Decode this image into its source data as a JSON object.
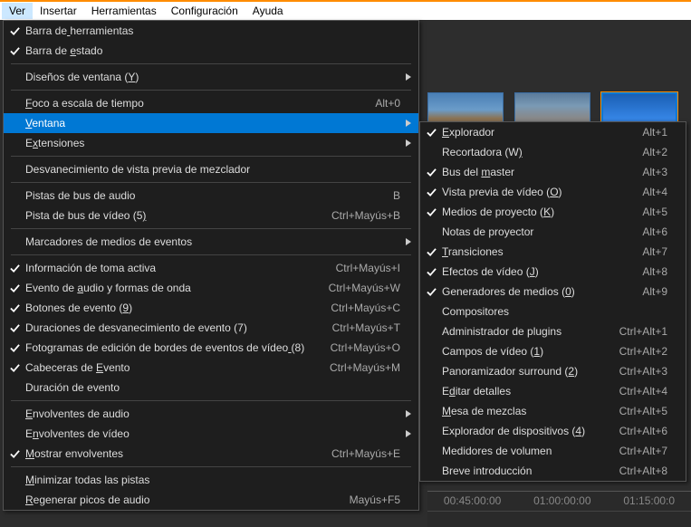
{
  "menubar": {
    "items": [
      "Ver",
      "Insertar",
      "Herramientas",
      "Configuración",
      "Ayuda"
    ],
    "active": 0
  },
  "menu1": [
    {
      "type": "item",
      "check": true,
      "label": "Barra de herramientas",
      "u": 8
    },
    {
      "type": "item",
      "check": true,
      "label": "Barra de estado",
      "u": 9
    },
    {
      "type": "sep"
    },
    {
      "type": "item",
      "label": "Diseños de ventana (Y)",
      "u": 20,
      "arrow": true
    },
    {
      "type": "sep"
    },
    {
      "type": "item",
      "label": "Foco a escala de tiempo",
      "u": 0,
      "shortcut": "Alt+0"
    },
    {
      "type": "item",
      "label": "Ventana",
      "u": 0,
      "arrow": true,
      "highlighted": true
    },
    {
      "type": "item",
      "label": "Extensiones",
      "u": 1,
      "arrow": true
    },
    {
      "type": "sep"
    },
    {
      "type": "item",
      "label": "Desvanecimiento de vista previa de mezclador"
    },
    {
      "type": "sep"
    },
    {
      "type": "item",
      "label": "Pistas de bus de audio",
      "shortcut": "B"
    },
    {
      "type": "item",
      "label": "Pista de bus de vídeo (5)",
      "u": 24,
      "shortcut": "Ctrl+Mayús+B"
    },
    {
      "type": "sep"
    },
    {
      "type": "item",
      "label": "Marcadores de medios de eventos",
      "arrow": true
    },
    {
      "type": "sep"
    },
    {
      "type": "item",
      "check": true,
      "label": "Información de toma activa",
      "shortcut": "Ctrl+Mayús+I"
    },
    {
      "type": "item",
      "check": true,
      "label": "Evento de audio y formas de onda",
      "u": 10,
      "shortcut": "Ctrl+Mayús+W"
    },
    {
      "type": "item",
      "check": true,
      "label": "Botones de evento (9)",
      "u": 19,
      "shortcut": "Ctrl+Mayús+C"
    },
    {
      "type": "item",
      "check": true,
      "label": "Duraciones de desvanecimiento de evento (7)",
      "u": 43,
      "shortcut": "Ctrl+Mayús+T"
    },
    {
      "type": "item",
      "check": true,
      "label": "Fotogramas de edición de bordes de eventos de vídeo (8)",
      "u": 51,
      "shortcut": "Ctrl+Mayús+O"
    },
    {
      "type": "item",
      "check": true,
      "label": "Cabeceras de Evento",
      "u": 13,
      "shortcut": "Ctrl+Mayús+M"
    },
    {
      "type": "item",
      "label": "Duración de evento"
    },
    {
      "type": "sep"
    },
    {
      "type": "item",
      "label": "Envolventes de audio",
      "u": 0,
      "arrow": true
    },
    {
      "type": "item",
      "label": "Envolventes de vídeo",
      "u": 1,
      "arrow": true
    },
    {
      "type": "item",
      "check": true,
      "label": "Mostrar envolventes",
      "u": 0,
      "shortcut": "Ctrl+Mayús+E"
    },
    {
      "type": "sep"
    },
    {
      "type": "item",
      "label": "Minimizar todas las pistas",
      "u": 0
    },
    {
      "type": "item",
      "label": "Regenerar picos de audio",
      "u": 0,
      "shortcut": "Mayús+F5"
    }
  ],
  "menu2": [
    {
      "type": "item",
      "check": true,
      "label": "Explorador",
      "u": 0,
      "shortcut": "Alt+1"
    },
    {
      "type": "item",
      "label": "Recortadora (W)",
      "u": 14,
      "shortcut": "Alt+2"
    },
    {
      "type": "item",
      "check": true,
      "label": "Bus del master",
      "u": 8,
      "shortcut": "Alt+3"
    },
    {
      "type": "item",
      "check": true,
      "label": "Vista previa de vídeo (O)",
      "u": 23,
      "shortcut": "Alt+4"
    },
    {
      "type": "item",
      "check": true,
      "label": "Medios de proyecto (K)",
      "u": 20,
      "shortcut": "Alt+5"
    },
    {
      "type": "item",
      "label": "Notas de proyector",
      "shortcut": "Alt+6"
    },
    {
      "type": "item",
      "check": true,
      "label": "Transiciones",
      "u": 0,
      "shortcut": "Alt+7"
    },
    {
      "type": "item",
      "check": true,
      "label": "Efectos de vídeo (J)",
      "u": 18,
      "shortcut": "Alt+8"
    },
    {
      "type": "item",
      "check": true,
      "label": "Generadores de medios (0)",
      "u": 23,
      "shortcut": "Alt+9"
    },
    {
      "type": "item",
      "label": "Compositores"
    },
    {
      "type": "item",
      "label": "Administrador de plugins",
      "shortcut": "Ctrl+Alt+1"
    },
    {
      "type": "item",
      "label": "Campos de vídeo (1)",
      "u": 17,
      "shortcut": "Ctrl+Alt+2"
    },
    {
      "type": "item",
      "label": "Panoramizador surround (2)",
      "u": 24,
      "shortcut": "Ctrl+Alt+3"
    },
    {
      "type": "item",
      "label": "Editar detalles",
      "u": 1,
      "shortcut": "Ctrl+Alt+4"
    },
    {
      "type": "item",
      "label": "Mesa de mezclas",
      "u": 0,
      "shortcut": "Ctrl+Alt+5"
    },
    {
      "type": "item",
      "label": "Explorador de dispositivos (4)",
      "u": 28,
      "shortcut": "Ctrl+Alt+6"
    },
    {
      "type": "item",
      "label": "Medidores de volumen",
      "shortcut": "Ctrl+Alt+7"
    },
    {
      "type": "item",
      "label": "Breve introducción",
      "shortcut": "Ctrl+Alt+8"
    }
  ],
  "timeline": {
    "marks": [
      "00:45:00:00",
      "01:00:00:00",
      "01:15:00:0"
    ]
  }
}
